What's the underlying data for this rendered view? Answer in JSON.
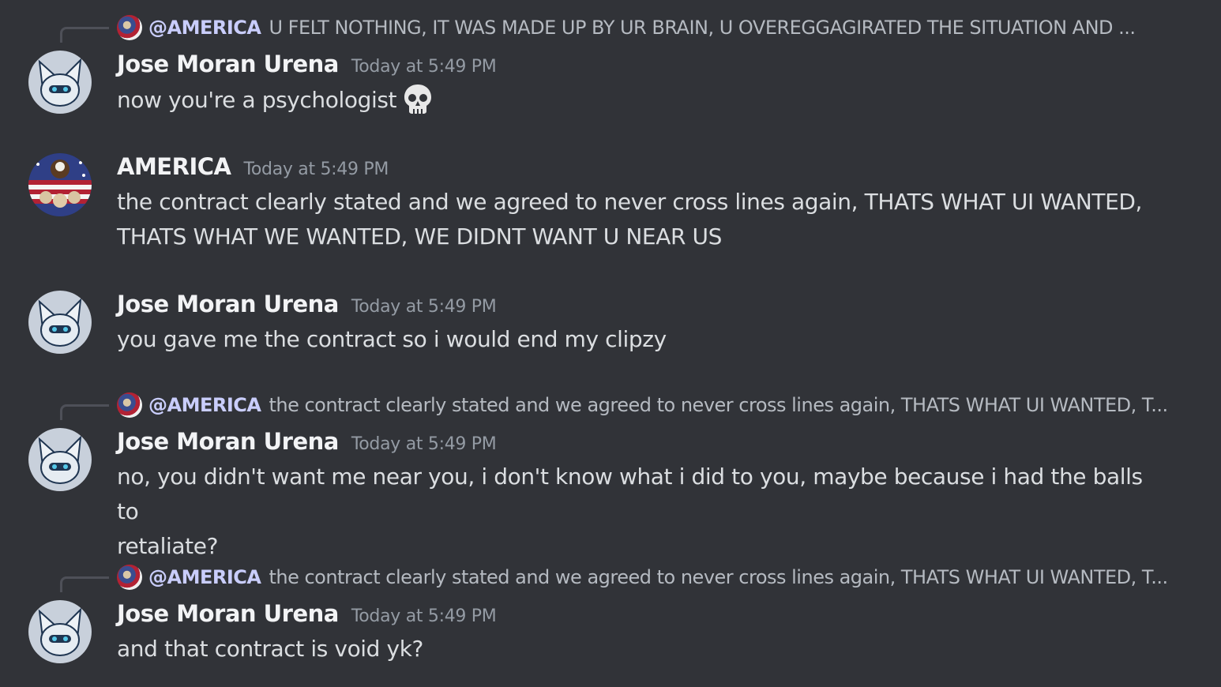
{
  "messages": [
    {
      "reply": {
        "mention": "@AMERICA",
        "text": "U FELT NOTHING, IT WAS MADE UP BY UR BRAIN, U OVEREGGAGIRATED THE SITUATION AND ..."
      },
      "author": "Jose Moran Urena",
      "timestamp": "Today at 5:49 PM",
      "text": "now you're a psychologist",
      "emoji": "skull-emoji"
    },
    {
      "author": "AMERICA",
      "timestamp": "Today at 5:49 PM",
      "text_line1": "the contract clearly stated and we agreed to never cross lines again, THATS WHAT UI WANTED,",
      "text_line2": "THATS WHAT WE WANTED, WE DIDNT WANT U NEAR US"
    },
    {
      "author": "Jose Moran Urena",
      "timestamp": "Today at 5:49 PM",
      "text": "you gave me the contract so i would end my clipzy"
    },
    {
      "reply": {
        "mention": "@AMERICA",
        "text": "the contract clearly stated and we agreed to never cross lines again, THATS WHAT UI WANTED, T..."
      },
      "author": "Jose Moran Urena",
      "timestamp": "Today at 5:49 PM",
      "text_line1": "no, you didn't want me near you, i don't know what i did to you, maybe because i had the balls to",
      "text_line2": "retaliate?"
    },
    {
      "reply": {
        "mention": "@AMERICA",
        "text": "the contract clearly stated and we agreed to never cross lines again, THATS WHAT UI WANTED, T..."
      },
      "author": "Jose Moran Urena",
      "timestamp": "Today at 5:49 PM",
      "text": "and that contract is void yk?"
    }
  ],
  "colors": {
    "background": "#313338",
    "username": "#f2f3f5",
    "message_text": "#dbdee1",
    "timestamp": "#949ba4",
    "mention": "#c9cdfb"
  }
}
